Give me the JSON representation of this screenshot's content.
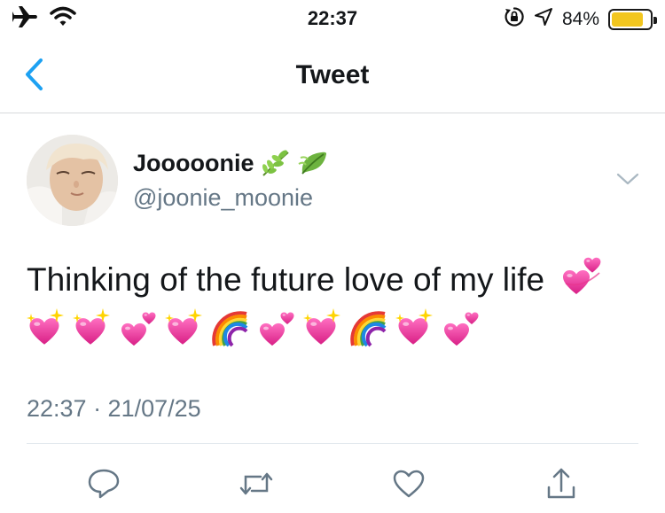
{
  "status_bar": {
    "time": "22:37",
    "battery_percent": "84%",
    "battery_level": 0.84,
    "icons": [
      "airplane-icon",
      "wifi-icon",
      "orientation-lock-icon",
      "location-arrow-icon",
      "battery-icon"
    ]
  },
  "nav": {
    "title": "Tweet",
    "back_icon": "chevron-left-icon"
  },
  "tweet": {
    "display_name": "Jooooonie",
    "name_emojis": [
      "herb",
      "leaf-fluttering-in-wind"
    ],
    "handle": "@joonie_moonie",
    "text": "Thinking of the future love of my life",
    "emojis": [
      "revolving-hearts",
      "sparkling-heart",
      "sparkling-heart",
      "two-hearts",
      "sparkling-heart",
      "rainbow",
      "two-hearts",
      "sparkling-heart",
      "rainbow",
      "sparkling-heart",
      "two-hearts"
    ],
    "timestamp": "22:37 · 21/07/25"
  },
  "actions": [
    "reply-icon",
    "retweet-icon",
    "like-icon",
    "share-icon"
  ],
  "colors": {
    "accent": "#1da1f2",
    "secondary_text": "#657786",
    "battery": "#f2c61f",
    "heart_pink": "#e8348f"
  }
}
